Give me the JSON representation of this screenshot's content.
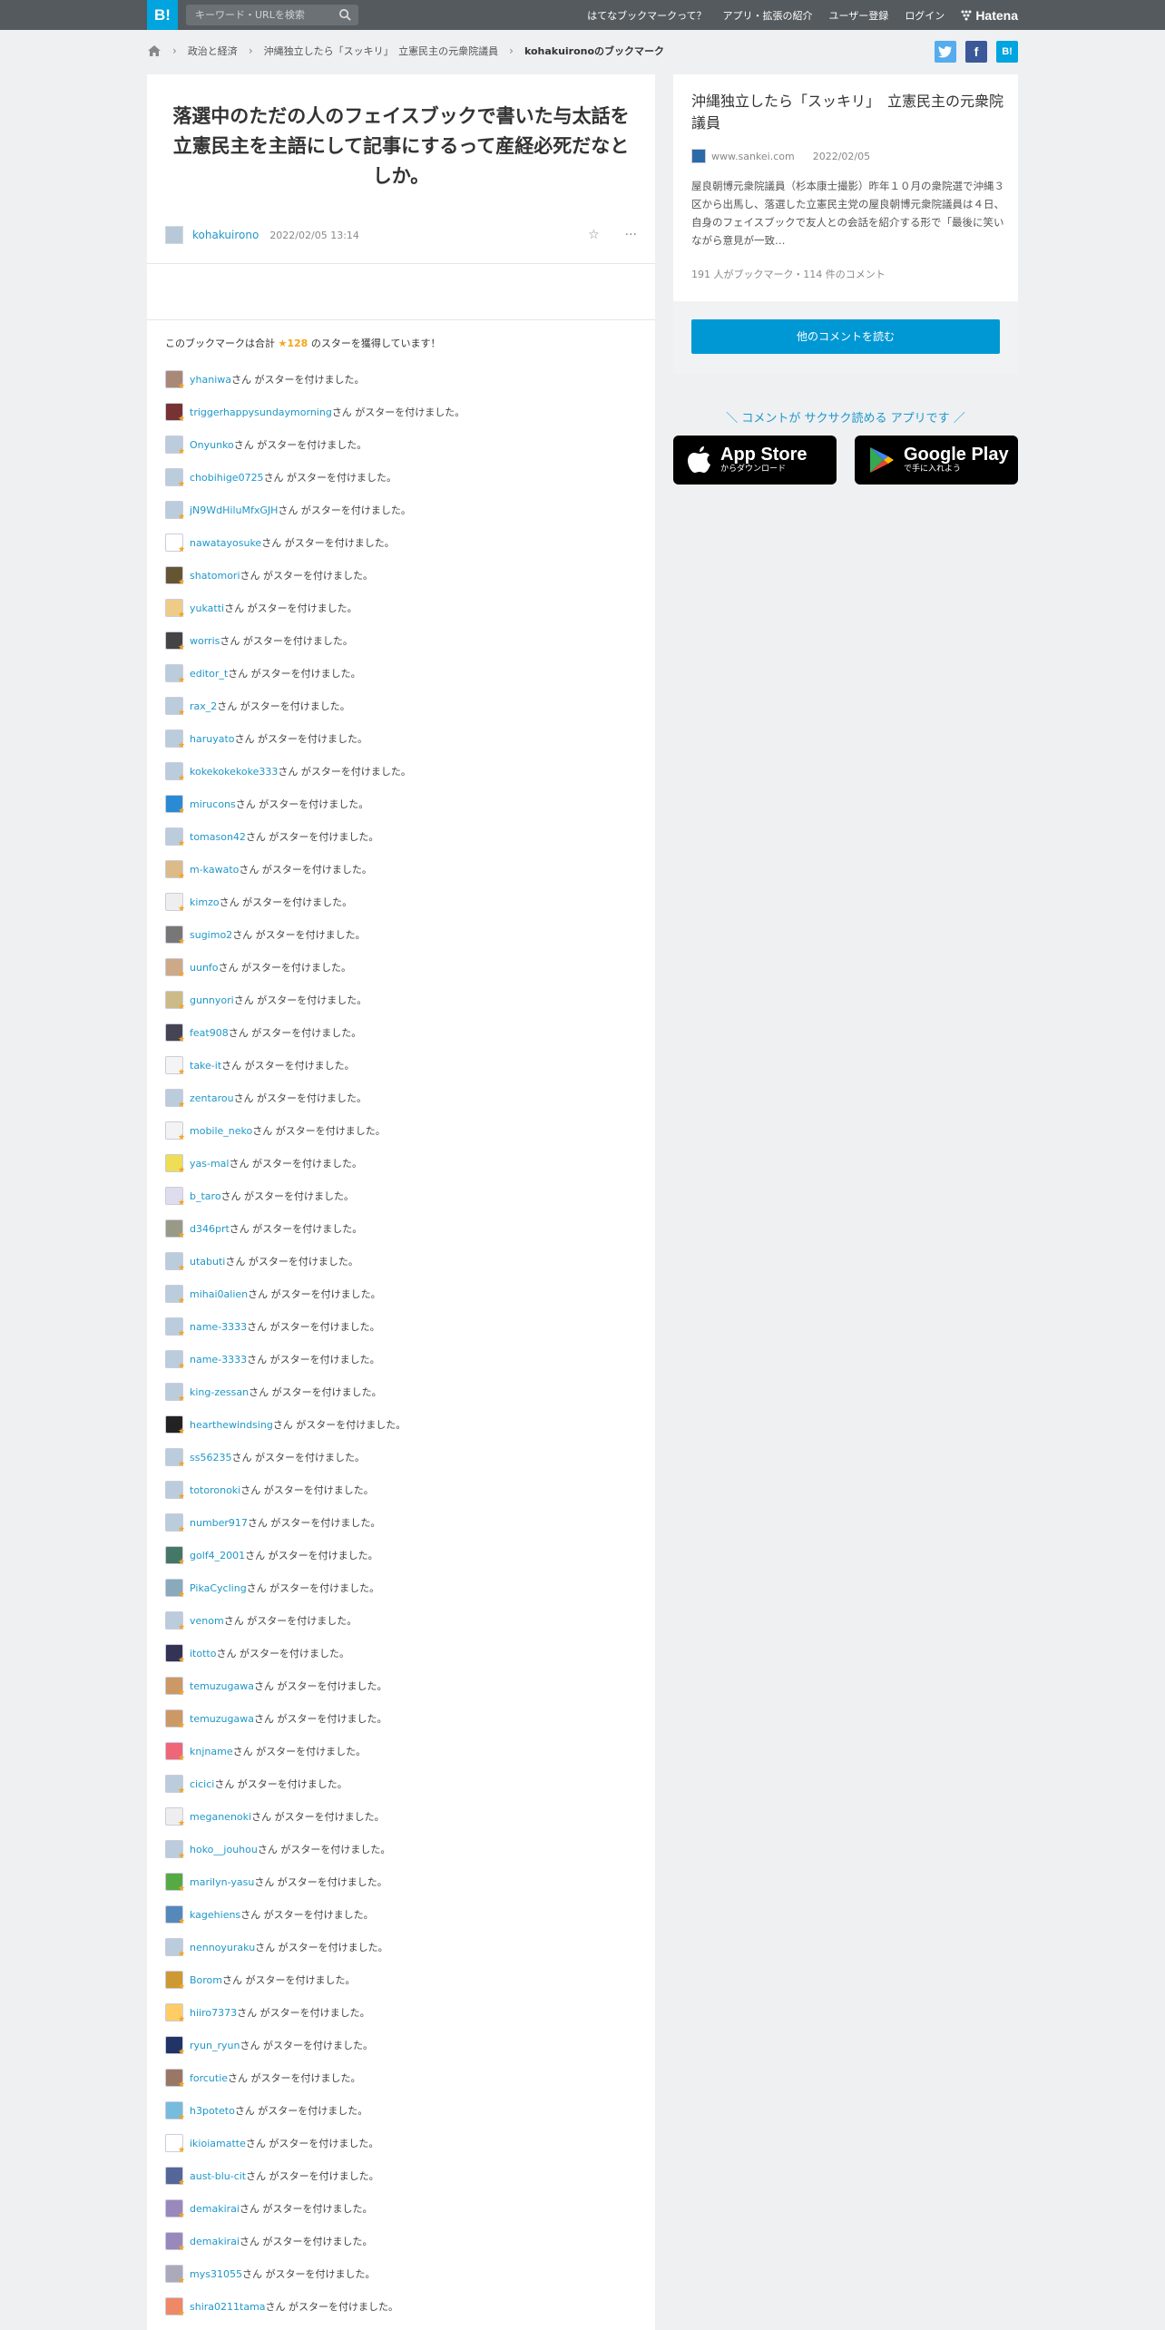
{
  "header": {
    "logo": "B!",
    "search_placeholder": "キーワード・URLを検索",
    "nav": [
      "はてなブックマークって？",
      "アプリ・拡張の紹介",
      "ユーザー登録",
      "ログイン"
    ],
    "brand": "Hatena"
  },
  "breadcrumb": [
    "政治と経済",
    "沖縄独立したら「スッキリ」　立憲民主の元衆院議員",
    "kohakuironoのブックマーク"
  ],
  "share": [
    "twitter-icon",
    "facebook-icon",
    "hatena-bookmark-icon"
  ],
  "entry": {
    "title": "落選中のただの人のフェイスブックで書いた与太話を立憲民主を主語にして記事にするって産経必死だなとしか。",
    "user": "kohakuirono",
    "date": "2022/02/05 13:14",
    "summary_prefix": "このブックマークは合計",
    "star_count": "★128",
    "summary_suffix": "のスターを獲得しています！"
  },
  "star_suffix": "さん がスターを付けました。",
  "stars": [
    {
      "name": "yhaniwa",
      "color": "#a87"
    },
    {
      "name": "triggerhappysundaymorning",
      "color": "#733"
    },
    {
      "name": "Onyunko",
      "color": "#bcd"
    },
    {
      "name": "chobihige0725",
      "color": "#bcd"
    },
    {
      "name": "jN9WdHiluMfxGJH",
      "color": "#bcd"
    },
    {
      "name": "nawatayosuke",
      "color": "#fff"
    },
    {
      "name": "shatomori",
      "color": "#653"
    },
    {
      "name": "yukatti",
      "color": "#ec8"
    },
    {
      "name": "worris",
      "color": "#444"
    },
    {
      "name": "editor_t",
      "color": "#bcd"
    },
    {
      "name": "rax_2",
      "color": "#bcd"
    },
    {
      "name": "haruyato",
      "color": "#bcd"
    },
    {
      "name": "kokekokekoke333",
      "color": "#bcd"
    },
    {
      "name": "mirucons",
      "color": "#2a8ad4"
    },
    {
      "name": "tomason42",
      "color": "#bcd"
    },
    {
      "name": "m-kawato",
      "color": "#db8"
    },
    {
      "name": "kimzo",
      "color": "#eee"
    },
    {
      "name": "sugimo2",
      "color": "#777"
    },
    {
      "name": "uunfo",
      "color": "#ca8"
    },
    {
      "name": "gunnyori",
      "color": "#cb8"
    },
    {
      "name": "feat908",
      "color": "#445"
    },
    {
      "name": "take-it",
      "color": "#f4f4f4"
    },
    {
      "name": "zentarou",
      "color": "#bcd"
    },
    {
      "name": "mobile_neko",
      "color": "#f3f3f3"
    },
    {
      "name": "yas-mal",
      "color": "#ed5"
    },
    {
      "name": "b_taro",
      "color": "#dde"
    },
    {
      "name": "d346prt",
      "color": "#998"
    },
    {
      "name": "utabuti",
      "color": "#bcd"
    },
    {
      "name": "mihai0alien",
      "color": "#bcd"
    },
    {
      "name": "name-3333",
      "color": "#bcd"
    },
    {
      "name": "name-3333",
      "color": "#bcd"
    },
    {
      "name": "king-zessan",
      "color": "#bcd"
    },
    {
      "name": "hearthewindsing",
      "color": "#222"
    },
    {
      "name": "ss56235",
      "color": "#bcd"
    },
    {
      "name": "totoronoki",
      "color": "#bcd"
    },
    {
      "name": "number917",
      "color": "#bcd"
    },
    {
      "name": "golf4_2001",
      "color": "#476"
    },
    {
      "name": "PikaCycling",
      "color": "#8ab"
    },
    {
      "name": "venom",
      "color": "#bcd"
    },
    {
      "name": "itotto",
      "color": "#335"
    },
    {
      "name": "temuzugawa",
      "color": "#c96"
    },
    {
      "name": "temuzugawa",
      "color": "#c96"
    },
    {
      "name": "knjname",
      "color": "#e67"
    },
    {
      "name": "cicici",
      "color": "#bcd"
    },
    {
      "name": "meganenoki",
      "color": "#eee"
    },
    {
      "name": "hoko__jouhou",
      "color": "#bcd"
    },
    {
      "name": "marilyn-yasu",
      "color": "#5a4"
    },
    {
      "name": "kagehiens",
      "color": "#58b"
    },
    {
      "name": "nennoyuraku",
      "color": "#bcd"
    },
    {
      "name": "Borom",
      "color": "#c93"
    },
    {
      "name": "hiiro7373",
      "color": "#fc6"
    },
    {
      "name": "ryun_ryun",
      "color": "#236"
    },
    {
      "name": "forcutie",
      "color": "#976"
    },
    {
      "name": "h3poteto",
      "color": "#7bd"
    },
    {
      "name": "ikioiamatte",
      "color": "#fff"
    },
    {
      "name": "aust-blu-cit",
      "color": "#569"
    },
    {
      "name": "demakirai",
      "color": "#98b"
    },
    {
      "name": "demakirai",
      "color": "#98b"
    },
    {
      "name": "mys31055",
      "color": "#aab"
    },
    {
      "name": "shira0211tama",
      "color": "#e86"
    }
  ],
  "sidebar": {
    "title": "沖縄独立したら「スッキリ」　立憲民主の元衆院議員",
    "source": "www.sankei.com",
    "date": "2022/02/05",
    "description": "屋良朝博元衆院議員（杉本康士撮影）昨年１０月の衆院選で沖縄３区から出馬し、落選した立憲民主党の屋良朝博元衆院議員は４日、自身のフェイスブックで友人との会話を紹介する形で「最後に笑いながら意見が一致…",
    "stats": "191 人がブックマーク・114 件のコメント",
    "button": "他のコメントを読む",
    "promo": "＼ コメントが サクサク読める アプリです ／",
    "appstore_main": "App Store",
    "appstore_sub": "からダウンロード",
    "gplay_main": "Google Play",
    "gplay_sub": "で手に入れよう"
  }
}
